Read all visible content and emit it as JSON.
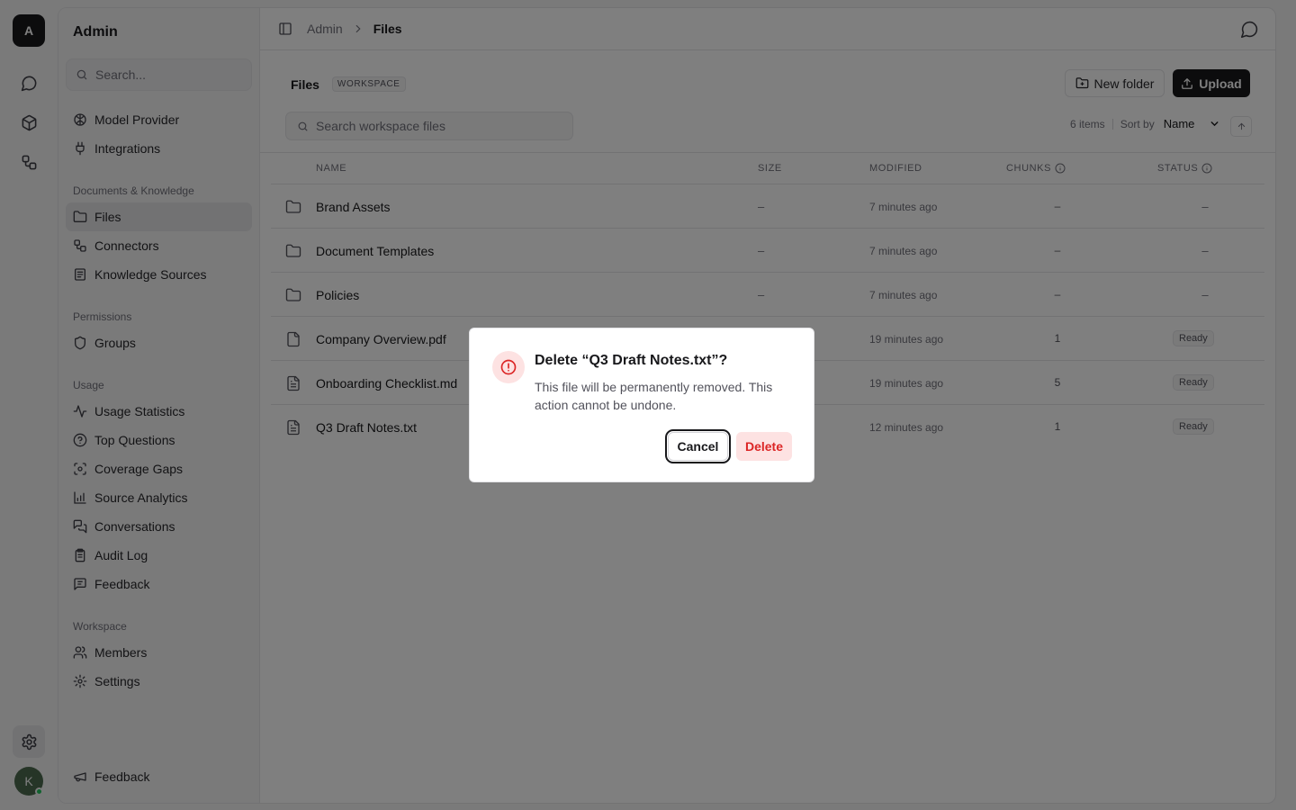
{
  "rail": {
    "logo_letter": "A",
    "avatar_letter": "K",
    "icons": [
      "chat-icon",
      "cube-icon",
      "workflow-icon",
      "gear-icon"
    ]
  },
  "sidebar": {
    "title": "Admin",
    "search_placeholder": "Search...",
    "top_items": [
      {
        "label": "Model Provider",
        "icon": "brain-icon"
      },
      {
        "label": "Integrations",
        "icon": "plug-icon"
      }
    ],
    "sections": [
      {
        "title": "Documents & Knowledge",
        "items": [
          {
            "label": "Files",
            "icon": "folder-icon",
            "active": true
          },
          {
            "label": "Connectors",
            "icon": "connectors-icon"
          },
          {
            "label": "Knowledge Sources",
            "icon": "book-icon"
          }
        ]
      },
      {
        "title": "Permissions",
        "items": [
          {
            "label": "Groups",
            "icon": "shield-icon"
          }
        ]
      },
      {
        "title": "Usage",
        "items": [
          {
            "label": "Usage Statistics",
            "icon": "activity-icon"
          },
          {
            "label": "Top Questions",
            "icon": "question-icon"
          },
          {
            "label": "Coverage Gaps",
            "icon": "scan-icon"
          },
          {
            "label": "Source Analytics",
            "icon": "bar-chart-icon"
          },
          {
            "label": "Conversations",
            "icon": "messages-icon"
          },
          {
            "label": "Audit Log",
            "icon": "clipboard-icon"
          },
          {
            "label": "Feedback",
            "icon": "message-square-icon"
          }
        ]
      },
      {
        "title": "Workspace",
        "items": [
          {
            "label": "Members",
            "icon": "users-icon"
          },
          {
            "label": "Settings",
            "icon": "settings-icon"
          }
        ]
      }
    ],
    "footer_item": {
      "label": "Feedback",
      "icon": "megaphone-icon"
    }
  },
  "topbar": {
    "breadcrumb": [
      "Admin",
      "Files"
    ]
  },
  "page": {
    "title": "Files",
    "badge": "WORKSPACE",
    "new_folder_label": "New folder",
    "upload_label": "Upload",
    "search_placeholder": "Search workspace files",
    "item_count": "6 items",
    "sort_by_label": "Sort by",
    "sort_value": "Name"
  },
  "table": {
    "columns": {
      "name": "NAME",
      "size": "SIZE",
      "modified": "MODIFIED",
      "chunks": "CHUNKS",
      "status": "STATUS"
    },
    "rows": [
      {
        "name": "Brand Assets",
        "type": "folder",
        "size": "–",
        "modified": "7 minutes ago",
        "chunks": "–",
        "status": "–"
      },
      {
        "name": "Document Templates",
        "type": "folder",
        "size": "–",
        "modified": "7 minutes ago",
        "chunks": "–",
        "status": "–"
      },
      {
        "name": "Policies",
        "type": "folder",
        "size": "–",
        "modified": "7 minutes ago",
        "chunks": "–",
        "status": "–"
      },
      {
        "name": "Company Overview.pdf",
        "type": "file",
        "size": "",
        "modified": "19 minutes ago",
        "chunks": "1",
        "status": "Ready"
      },
      {
        "name": "Onboarding Checklist.md",
        "type": "text",
        "size": "",
        "modified": "19 minutes ago",
        "chunks": "5",
        "status": "Ready"
      },
      {
        "name": "Q3 Draft Notes.txt",
        "type": "text",
        "size": "",
        "modified": "12 minutes ago",
        "chunks": "1",
        "status": "Ready"
      }
    ]
  },
  "dialog": {
    "title": "Delete “Q3 Draft Notes.txt”?",
    "body": "This file will be permanently removed. This action cannot be undone.",
    "cancel_label": "Cancel",
    "delete_label": "Delete"
  },
  "colors": {
    "accent": "#18181b",
    "danger": "#dc2626",
    "danger_bg": "#fde2e2",
    "app_bg": "#f4f4f5"
  }
}
